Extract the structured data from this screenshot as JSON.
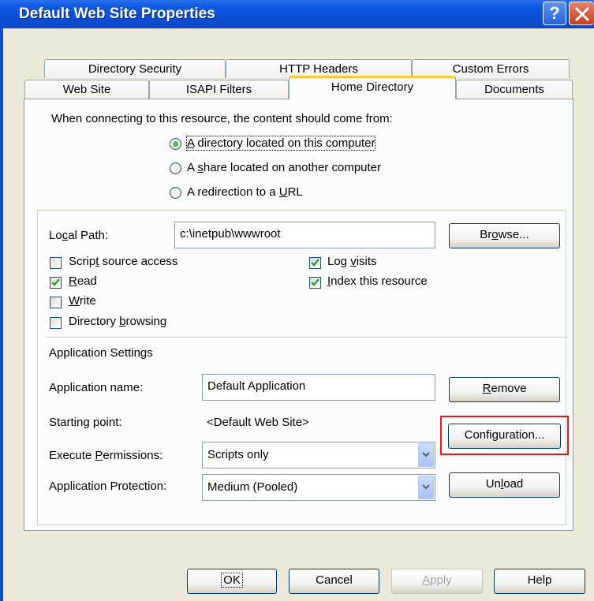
{
  "window": {
    "title": "Default Web Site Properties",
    "help_glyph": "?",
    "accent_color": "#0a4fd6"
  },
  "tabs": {
    "row_back": [
      "Directory Security",
      "HTTP Headers",
      "Custom Errors"
    ],
    "row_front": [
      "Web Site",
      "ISAPI Filters",
      "Home Directory",
      "Documents"
    ],
    "active": "Home Directory"
  },
  "content_source": {
    "prompt": "When connecting to this resource, the content should come from:",
    "options": [
      {
        "pre": "",
        "u": "A",
        "post": " directory located on this computer",
        "selected": true
      },
      {
        "pre": "A ",
        "u": "s",
        "post": "hare located on another computer",
        "selected": false
      },
      {
        "pre": "A redirection to a ",
        "u": "U",
        "post": "RL",
        "selected": false
      }
    ]
  },
  "local_path": {
    "label_pre": "Lo",
    "label_u": "c",
    "label_post": "al Path:",
    "value": "c:\\inetpub\\wwwroot",
    "browse_pre": "Br",
    "browse_u": "o",
    "browse_post": "wse..."
  },
  "permissions": {
    "script_source": {
      "pre": "Scrip",
      "u": "t",
      "post": " source access",
      "checked": false
    },
    "read": {
      "pre": "",
      "u": "R",
      "post": "ead",
      "checked": true
    },
    "write": {
      "pre": "",
      "u": "W",
      "post": "rite",
      "checked": false
    },
    "dir_browsing": {
      "pre": "Directory ",
      "u": "b",
      "post": "rowsing",
      "checked": false
    },
    "log_visits": {
      "pre": "Log ",
      "u": "v",
      "post": "isits",
      "checked": true
    },
    "index_resource": {
      "pre": "",
      "u": "I",
      "post": "ndex this resource",
      "checked": true
    }
  },
  "app_settings": {
    "heading": "Application Settings",
    "name_label": "Application name:",
    "name_value": "Default Application",
    "remove_pre": "",
    "remove_u": "R",
    "remove_post": "emove",
    "start_label": "Starting point:",
    "start_value": "<Default Web Site>",
    "config_label": "Configuration...",
    "exec_label_pre": "Execute ",
    "exec_label_u": "P",
    "exec_label_post": "ermissions:",
    "exec_value": "Scripts only",
    "protect_label": "Application Protection:",
    "protect_value": "Medium (Pooled)",
    "unload_pre": "Un",
    "unload_u": "l",
    "unload_post": "oad"
  },
  "footer": {
    "ok": "OK",
    "cancel": "Cancel",
    "apply_pre": "",
    "apply_u": "A",
    "apply_post": "pply",
    "help": "Help"
  },
  "highlight_color": "#e31b1b"
}
